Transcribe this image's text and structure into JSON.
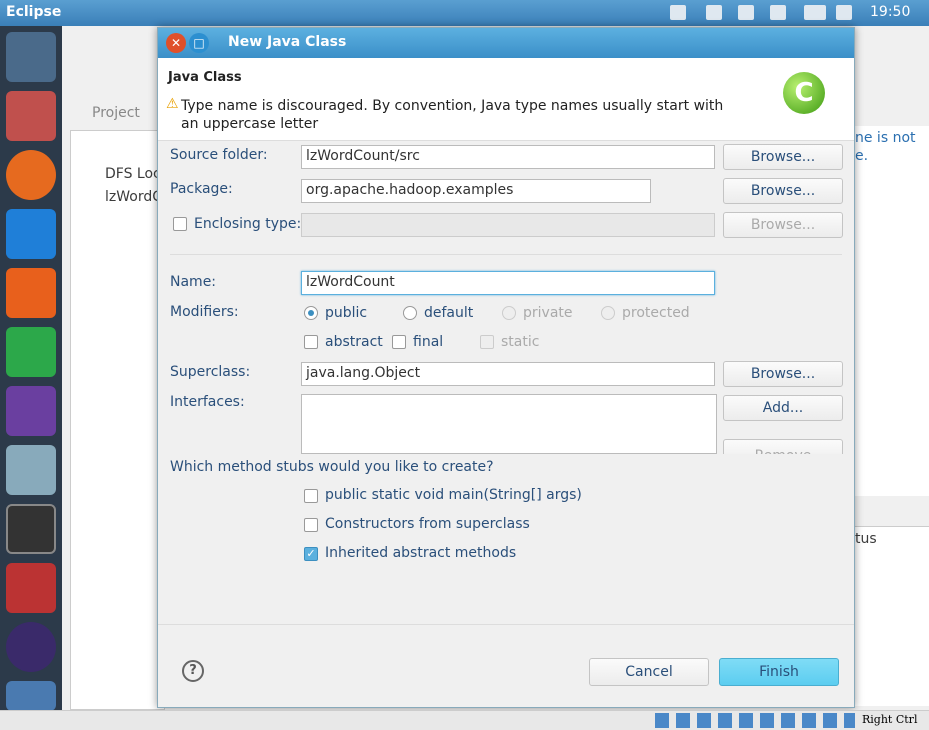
{
  "topbar": {
    "title": "Eclipse",
    "clock": "19:50"
  },
  "eclipse": {
    "project_tab": "Project",
    "tree": [
      "DFS Loc",
      "lzWordC"
    ],
    "right_text1": "ne is not",
    "right_text2": "e.",
    "right_col": "tus"
  },
  "dialog": {
    "title": "New Java Class",
    "header_title": "Java Class",
    "warning": "Type name is discouraged. By convention, Java type names usually start with an uppercase letter",
    "source_folder": {
      "label": "Source folder:",
      "value": "lzWordCount/src",
      "button": "Browse..."
    },
    "package": {
      "label": "Package:",
      "value": "org.apache.hadoop.examples",
      "button": "Browse..."
    },
    "enclosing": {
      "label": "Enclosing type:",
      "value": "",
      "button": "Browse...",
      "checked": false
    },
    "name": {
      "label": "Name:",
      "value": "lzWordCount"
    },
    "modifiers": {
      "label": "Modifiers:",
      "access": [
        {
          "label": "public",
          "selected": true
        },
        {
          "label": "default"
        },
        {
          "label": "private",
          "disabled": true
        },
        {
          "label": "protected",
          "disabled": true
        }
      ],
      "flags": [
        {
          "label": "abstract",
          "checked": false
        },
        {
          "label": "final",
          "checked": false
        },
        {
          "label": "static",
          "disabled": true
        }
      ]
    },
    "superclass": {
      "label": "Superclass:",
      "value": "java.lang.Object",
      "button": "Browse..."
    },
    "interfaces": {
      "label": "Interfaces:",
      "add": "Add...",
      "remove": "Remove"
    },
    "stubs": {
      "question": "Which method stubs would you like to create?",
      "items": [
        {
          "label": "public static void main(String[] args)",
          "checked": false
        },
        {
          "label": "Constructors from superclass",
          "checked": false
        },
        {
          "label": "Inherited abstract methods",
          "checked": true
        }
      ]
    },
    "cancel": "Cancel",
    "finish": "Finish",
    "help": "?"
  },
  "statusbar": {
    "host_key": "Right Ctrl"
  },
  "colors": {
    "accent": "#3b8fc8",
    "finish": "#6fd3f2"
  }
}
